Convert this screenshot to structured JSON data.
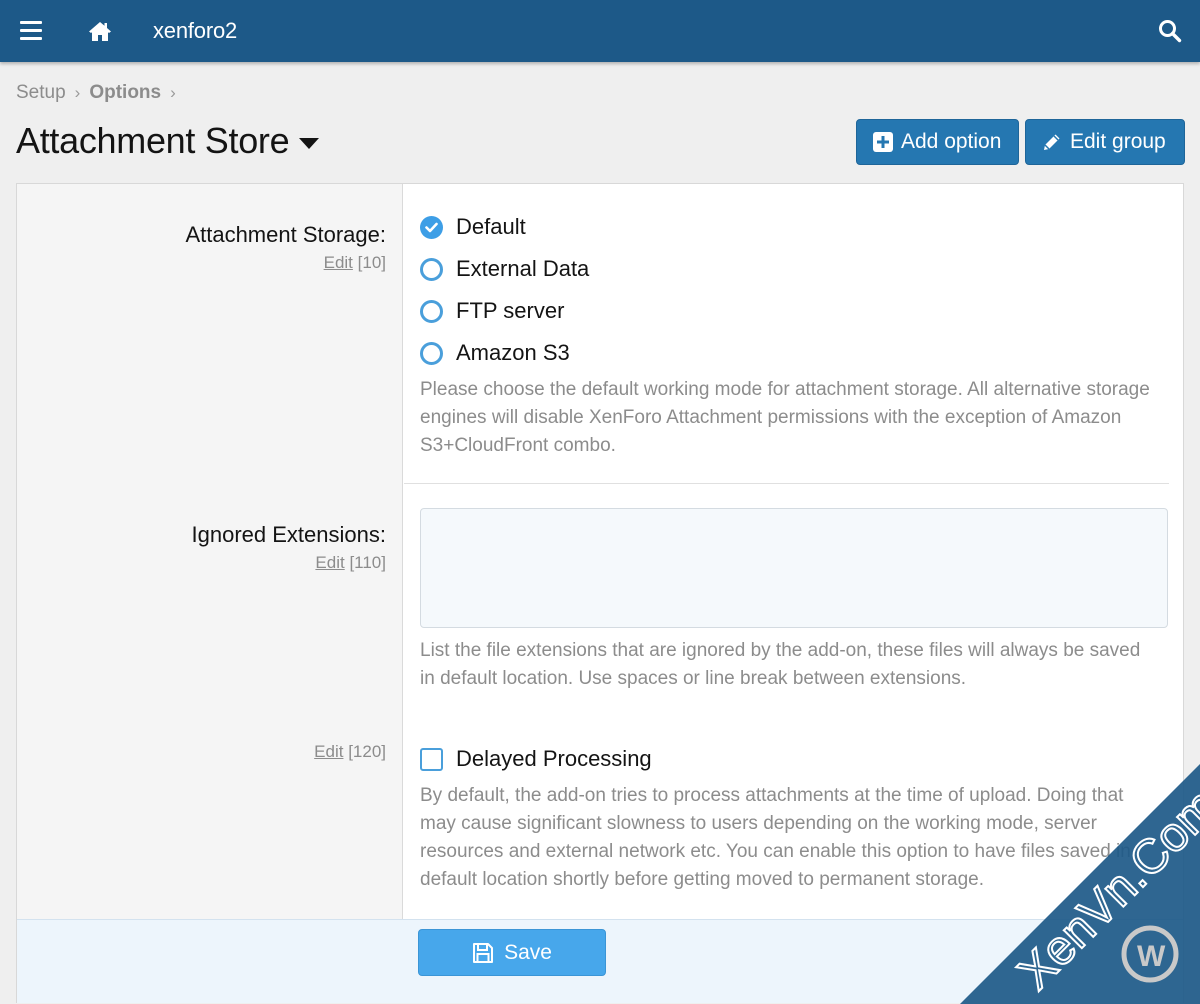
{
  "topbar": {
    "brand": "xenforo2",
    "menu_icon": "hamburger-icon",
    "home_icon": "home-icon",
    "search_icon": "search-icon",
    "background": "#1d5988"
  },
  "breadcrumb": {
    "items": [
      "Setup",
      "Options"
    ],
    "separator": "›"
  },
  "page": {
    "title": "Attachment Store"
  },
  "actions": {
    "add_option": "Add option",
    "edit_group": "Edit group"
  },
  "options": {
    "storage": {
      "label": "Attachment Storage:",
      "edit_link": "Edit",
      "order": "[10]",
      "choices": [
        {
          "label": "Default",
          "selected": true
        },
        {
          "label": "External Data",
          "selected": false
        },
        {
          "label": "FTP server",
          "selected": false
        },
        {
          "label": "Amazon S3",
          "selected": false
        }
      ],
      "explain": "Please choose the default working mode for attachment storage. All alternative storage engines will disable XenForo Attachment permissions with the exception of Amazon S3+CloudFront combo."
    },
    "ignored": {
      "label": "Ignored Extensions:",
      "edit_link": "Edit",
      "order": "[110]",
      "value": "",
      "explain": "List the file extensions that are ignored by the add-on, these files will always be saved in default location. Use spaces or line break between extensions."
    },
    "delayed": {
      "edit_link": "Edit",
      "order": "[120]",
      "label": "Delayed Processing",
      "checked": false,
      "explain": "By default, the add-on tries to process attachments at the time of upload. Doing that may cause significant slowness to users depending on the working mode, server resources and external network etc. You can enable this option to have files saved in default location shortly before getting moved to permanent storage."
    }
  },
  "footer": {
    "save_label": "Save"
  },
  "watermark": {
    "text": "XenVn.Com",
    "logo_letter": "W"
  }
}
